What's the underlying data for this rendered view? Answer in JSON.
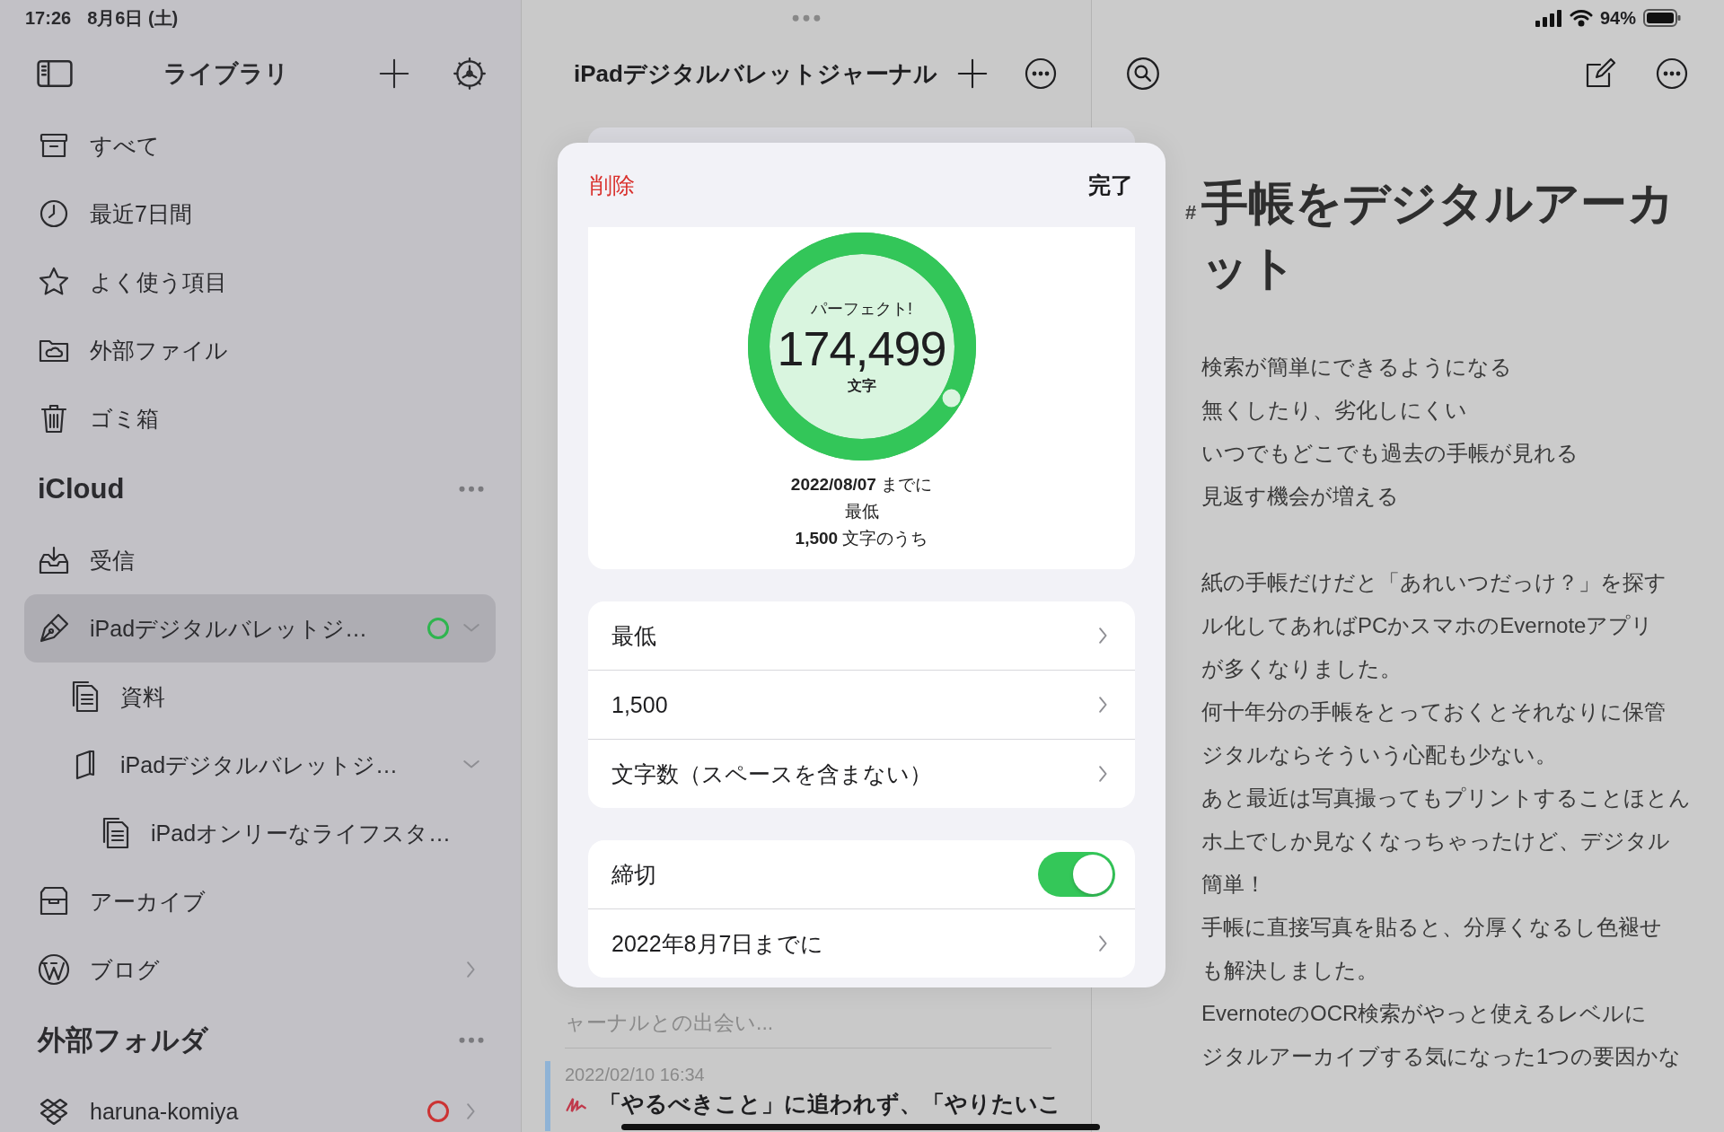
{
  "status_bar": {
    "time": "17:26",
    "date": "8月6日 (土)",
    "battery": "94%"
  },
  "sidebar": {
    "title": "ライブラリ",
    "library": [
      {
        "label": "すべて",
        "selected": false
      },
      {
        "label": "最近7日間",
        "selected": false
      },
      {
        "label": "よく使う項目",
        "selected": false
      },
      {
        "label": "外部ファイル",
        "selected": false
      },
      {
        "label": "ゴミ箱",
        "selected": false
      }
    ],
    "sections": [
      {
        "title": "iCloud",
        "items": [
          {
            "label": "受信",
            "selected": false
          },
          {
            "label": "iPadデジタルバレットジ…",
            "selected": true,
            "expanded": true,
            "color": "#2fb54f",
            "children": [
              {
                "label": "資料",
                "selected": false
              },
              {
                "label": "iPadデジタルバレットジ…",
                "selected": false,
                "expanded": true,
                "children": [
                  {
                    "label": "iPadオンリーなライフスタ…",
                    "selected": false
                  }
                ]
              }
            ]
          },
          {
            "label": "アーカイブ",
            "selected": false
          },
          {
            "label": "ブログ",
            "selected": false,
            "expanded": false
          }
        ]
      },
      {
        "title": "外部フォルダ",
        "items": [
          {
            "label": "haruna-komiya",
            "selected": false,
            "expanded": false,
            "color": "#cc3333"
          }
        ]
      }
    ]
  },
  "note_list": {
    "title": "iPadデジタルバレットジャーナル",
    "notes": [
      {
        "excerpt": "ャーナルとの出会い...",
        "selected": false
      },
      {
        "date": "2022/02/10 16:34",
        "title": "「やるべきこと」に追われず、「やりたいこ",
        "selected": true
      }
    ]
  },
  "editor": {
    "heading_marker": "#",
    "heading_lines": [
      "手帳をデジタルアーカ",
      "ット"
    ],
    "paragraphs": [
      [
        "検索が簡単にできるようになる",
        "無くしたり、劣化しにくい",
        "いつでもどこでも過去の手帳が見れる",
        "見返す機会が増える"
      ],
      [
        "紙の手帳だけだと「あれいつだっけ？」を探す",
        "ル化してあればPCかスマホのEvernoteアプリ",
        "が多くなりました。",
        "何十年分の手帳をとっておくとそれなりに保管",
        "ジタルならそういう心配も少ない。",
        "あと最近は写真撮ってもプリントすることほとん",
        "ホ上でしか見なくなっちゃったけど、デジタル",
        "簡単！",
        "手帳に直接写真を貼ると、分厚くなるし色褪せ",
        "も解決しました。",
        "EvernoteのOCR検索がやっと使えるレベルに",
        "ジタルアーカイブする気になった1つの要因かな"
      ]
    ]
  },
  "goal_sheet": {
    "delete": "削除",
    "done": "完了",
    "ring": {
      "caption": "パーフェクト!",
      "count": "174,499",
      "unit": "文字"
    },
    "summary": [
      "**2022/08/07** までに",
      "最低",
      "**1,500** 文字のうち"
    ],
    "settings": [
      {
        "label": "最低"
      },
      {
        "label": "1,500"
      },
      {
        "label": "文字数（スペースを含まない）"
      }
    ],
    "deadline": {
      "label": "締切",
      "on": true,
      "date": "2022年8月7日までに"
    }
  }
}
